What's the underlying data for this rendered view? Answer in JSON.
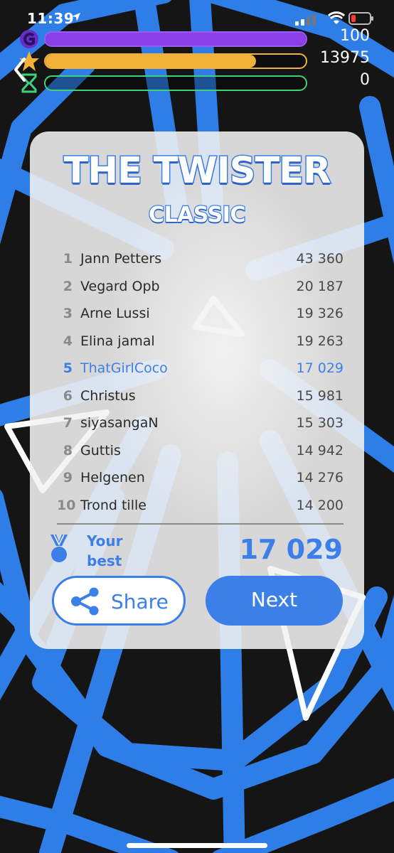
{
  "status_bar": {
    "time": "11:39"
  },
  "resources": [
    {
      "icon": "g-coin-icon",
      "value": "100",
      "fill": 1.0,
      "color": "#8b3fe6"
    },
    {
      "icon": "star-icon",
      "value": "13975",
      "fill": 0.81,
      "color": "#f2b23a"
    },
    {
      "icon": "hourglass-icon",
      "value": "0",
      "fill": 0.0,
      "color": "#3dd27a"
    }
  ],
  "card": {
    "title": "THE TWISTER",
    "subtitle": "CLASSIC",
    "leaderboard": [
      {
        "rank": "1",
        "name": "Jann Petters",
        "score": "43 360"
      },
      {
        "rank": "2",
        "name": "Vegard Opb",
        "score": "20 187"
      },
      {
        "rank": "3",
        "name": "Arne Lussi",
        "score": "19 326"
      },
      {
        "rank": "4",
        "name": "Elina jamal",
        "score": "19 263"
      },
      {
        "rank": "5",
        "name": "ThatGirlCoco",
        "score": "17 029",
        "highlight": true
      },
      {
        "rank": "6",
        "name": "Christus",
        "score": "15 981"
      },
      {
        "rank": "7",
        "name": "siyasangaN",
        "score": "15 303"
      },
      {
        "rank": "8",
        "name": "Guttis",
        "score": "14 942"
      },
      {
        "rank": "9",
        "name": "Helgenen",
        "score": "14 276"
      },
      {
        "rank": "10",
        "name": "Trond tille",
        "score": "14 200"
      }
    ],
    "your_best_label": "Your best",
    "your_best_value": "17 029",
    "share_label": "Share",
    "next_label": "Next"
  },
  "colors": {
    "accent": "#3d7fe8",
    "web": "#2f7de6"
  }
}
